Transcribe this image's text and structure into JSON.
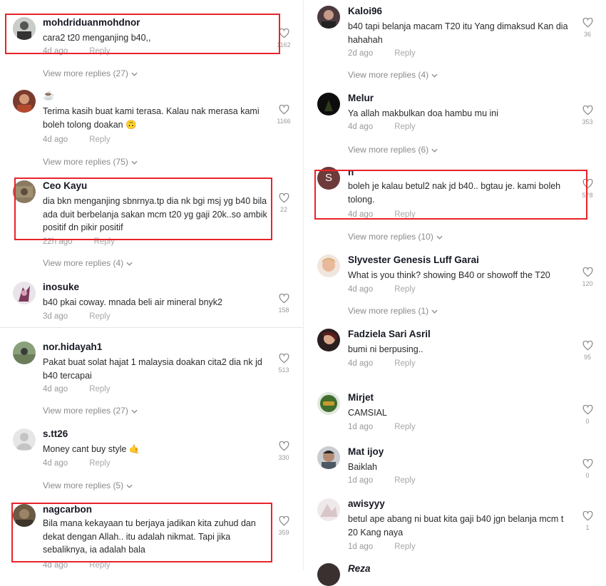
{
  "left": {
    "comments": [
      {
        "user": "mohdriduanmohdnor",
        "text": "cara2 t20 menganjing b40,,",
        "time": "4d ago",
        "reply": "Reply",
        "likes": "1162",
        "view_more": "View more replies (27)"
      },
      {
        "user": "",
        "user_emoji": "☕",
        "text": "Terima kasih buat kami terasa. Kalau nak merasa kami boleh tolong doakan 🙃",
        "time": "4d ago",
        "reply": "Reply",
        "likes": "1166",
        "view_more": "View more replies (75)"
      },
      {
        "user": "Ceo Kayu",
        "text": "dia bkn menganjing sbnrnya.tp dia nk bgi msj yg b40 bila ada duit berbelanja sakan mcm t20 yg gaji 20k..so ambik positif dn pikir positif",
        "time": "22h ago",
        "reply": "Reply",
        "likes": "22",
        "view_more": "View more replies (4)"
      },
      {
        "user": "inosuke",
        "text": "b40 pkai coway. mnada beli air mineral bnyk2",
        "time": "3d ago",
        "reply": "Reply",
        "likes": "158"
      },
      {
        "user": "nor.hidayah1",
        "text": "Pakat buat solat hajat 1 malaysia doakan cita2 dia nk jd b40 tercapai",
        "time": "4d ago",
        "reply": "Reply",
        "likes": "513",
        "view_more": "View more replies (27)"
      },
      {
        "user": "s.tt26",
        "text": "Money cant buy style 🤙",
        "time": "4d ago",
        "reply": "Reply",
        "likes": "330",
        "view_more": "View more replies (5)"
      },
      {
        "user": "nagcarbon",
        "text": "Bila mana kekayaan tu berjaya jadikan kita zuhud dan dekat dengan Allah.. itu adalah nikmat. Tapi jika sebaliknya, ia adalah bala",
        "time": "4d ago",
        "reply": "Reply",
        "likes": "359"
      }
    ]
  },
  "right": {
    "comments": [
      {
        "user": "Kaloi96",
        "text": "b40 tapi belanja macam T20 itu Yang dimaksud Kan dia hahahah",
        "time": "2d ago",
        "reply": "Reply",
        "likes": "36",
        "view_more": "View more replies (4)"
      },
      {
        "user": "Melur",
        "text": "Ya allah makbulkan doa hambu mu ini",
        "time": "4d ago",
        "reply": "Reply",
        "likes": "353",
        "view_more": "View more replies (6)"
      },
      {
        "user": "n",
        "avatar_letter": "S",
        "text": "boleh je kalau betul2 nak jd b40.. bgtau je. kami boleh tolong.",
        "time": "4d ago",
        "reply": "Reply",
        "likes": "578",
        "view_more": "View more replies (10)"
      },
      {
        "user": "Slyvester Genesis Luff Garai",
        "text": "What is you think? showing B40 or showoff the T20",
        "time": "4d ago",
        "reply": "Reply",
        "likes": "120",
        "view_more": "View more replies (1)"
      },
      {
        "user": "Fadziela Sari Asril",
        "text": "bumi ni berpusing..",
        "time": "4d ago",
        "reply": "Reply",
        "likes": "95"
      },
      {
        "user": "Mirjet",
        "text": "CAMSIAL",
        "time": "1d ago",
        "reply": "Reply",
        "likes": "0"
      },
      {
        "user": "Mat ijoy",
        "text": "Baiklah",
        "time": "1d ago",
        "reply": "Reply",
        "likes": "0"
      },
      {
        "user": "awisyyy",
        "text": "betul ape abang ni buat kita gaji b40 jgn belanja mcm t 20 Kang naya",
        "time": "1d ago",
        "reply": "Reply",
        "likes": "1"
      },
      {
        "user": "Reza",
        "text": "",
        "time": "",
        "reply": "",
        "likes": ""
      }
    ]
  },
  "colors": {
    "highlight": "#e8232a",
    "muted": "#9a9a9a",
    "text": "#161823"
  },
  "icons": {
    "like": "heart-outline-icon",
    "expand": "chevron-down-icon"
  }
}
